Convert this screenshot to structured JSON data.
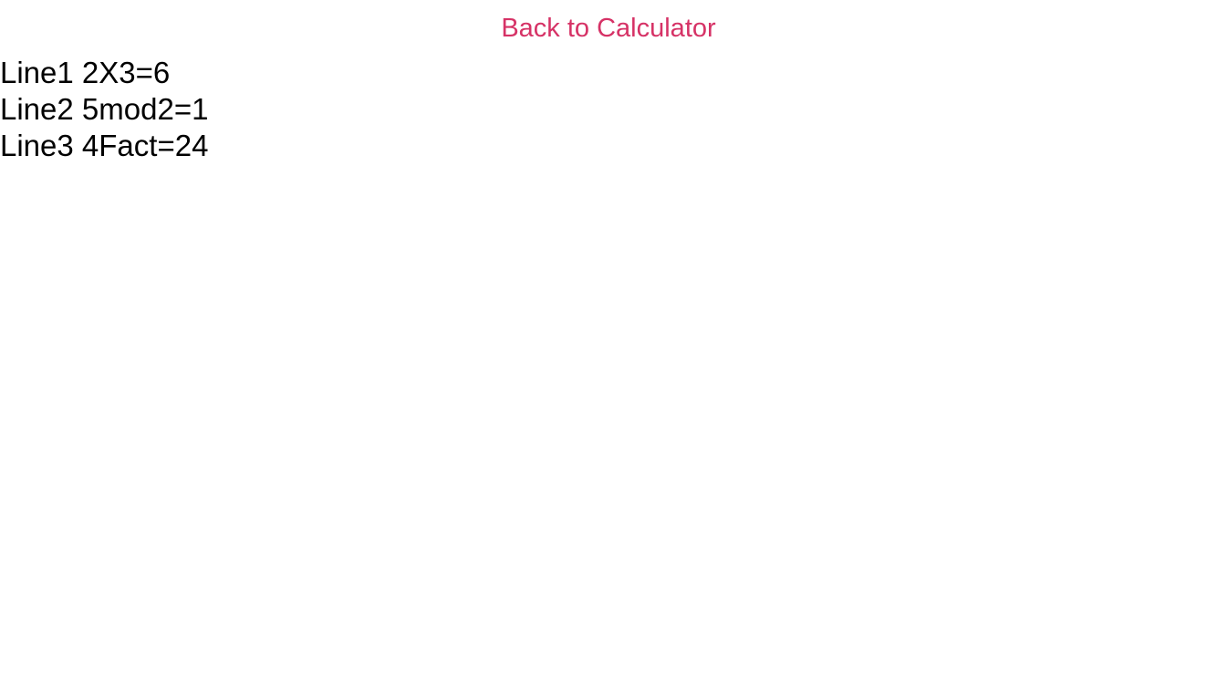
{
  "navigation": {
    "back_label": "Back to Calculator"
  },
  "history": {
    "lines": [
      "Line1 2X3=6",
      "Line2 5mod2=1",
      "Line3 4Fact=24"
    ]
  },
  "colors": {
    "accent": "#d63266",
    "text": "#000000",
    "background": "#ffffff"
  }
}
